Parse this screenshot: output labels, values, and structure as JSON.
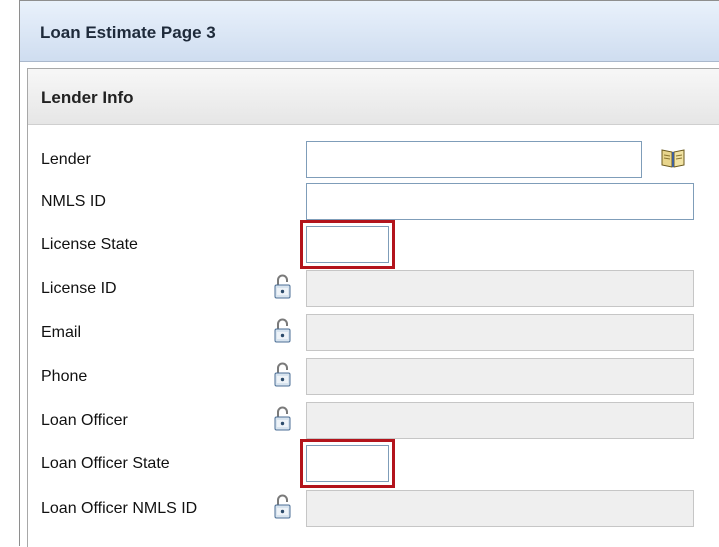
{
  "page": {
    "title": "Loan Estimate Page 3"
  },
  "section": {
    "title": "Lender Info"
  },
  "fields": {
    "lender": {
      "label": "Lender",
      "value": ""
    },
    "nmls_id": {
      "label": "NMLS ID",
      "value": ""
    },
    "license_state": {
      "label": "License State",
      "value": "",
      "highlighted": true
    },
    "license_id": {
      "label": "License ID",
      "value": "",
      "locked": true
    },
    "email": {
      "label": "Email",
      "value": "",
      "locked": true
    },
    "phone": {
      "label": "Phone",
      "value": "",
      "locked": true
    },
    "loan_officer": {
      "label": "Loan Officer",
      "value": "",
      "locked": true
    },
    "loan_officer_state": {
      "label": "Loan Officer State",
      "value": "",
      "highlighted": true
    },
    "loan_officer_nmls_id": {
      "label": "Loan Officer NMLS ID",
      "value": "",
      "locked": true
    }
  },
  "icons": {
    "lender_lookup": "address-book-icon",
    "lock": "padlock-unlocked-icon"
  },
  "colors": {
    "highlight_border": "#b3141c",
    "header_gradient_top": "#e9f1fb",
    "header_gradient_bottom": "#cfddf0"
  }
}
